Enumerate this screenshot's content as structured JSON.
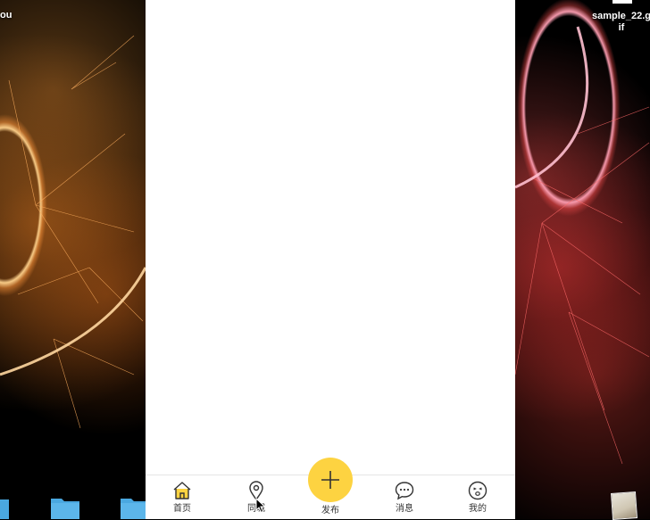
{
  "desktop": {
    "left_label": "ou",
    "right_label": "sample_22.g\nif",
    "wallpaper_left_accent": "#ff9a3c",
    "wallpaper_right_accent": "#ff5a5a",
    "folder_color": "#4aa8e0"
  },
  "app": {
    "background": "#ffffff",
    "accent": "#fdd341",
    "tabbar": {
      "tabs": [
        {
          "icon": "home-icon",
          "label": "首页"
        },
        {
          "icon": "location-pin-icon",
          "label": "同城"
        },
        {
          "icon": "plus-icon",
          "label": "发布"
        },
        {
          "icon": "chat-bubble-icon",
          "label": "消息"
        },
        {
          "icon": "smiley-face-icon",
          "label": "我的"
        }
      ]
    }
  }
}
